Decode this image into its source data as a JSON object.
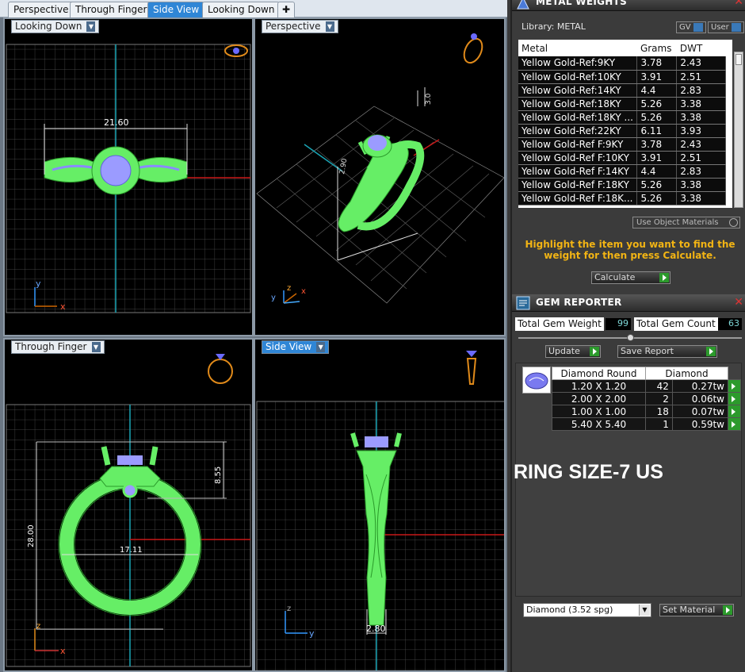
{
  "tabs": [
    {
      "label": "Perspective",
      "active": false
    },
    {
      "label": "Through Finger",
      "active": false
    },
    {
      "label": "Side View",
      "active": true
    },
    {
      "label": "Looking Down",
      "active": false
    }
  ],
  "viewports": {
    "looking_down": {
      "label": "Looking Down",
      "dim_width": "21.60",
      "axis_y": "y",
      "axis_x": "x"
    },
    "perspective": {
      "label": "Perspective",
      "dim_a": "3.0",
      "dim_b": "2.90",
      "axis_y": "y",
      "axis_z": "z",
      "axis_x": "x"
    },
    "through_finger": {
      "label": "Through Finger",
      "dim_height": "28.00",
      "dim_head": "8.55",
      "dim_inner": "17.11",
      "axis_z": "z",
      "axis_x": "x"
    },
    "side_view": {
      "label": "Side View",
      "dim_width": "2.80",
      "axis_z": "z",
      "axis_y": "y"
    }
  },
  "metal_weights": {
    "title": "METAL WEIGHTS",
    "library_label": "Library: METAL",
    "chip_gv": "GV",
    "chip_user": "User",
    "columns": [
      "Metal",
      "Grams",
      "DWT"
    ],
    "rows": [
      [
        "Yellow Gold-Ref:9KY",
        "3.78",
        "2.43"
      ],
      [
        "Yellow Gold-Ref:10KY",
        "3.91",
        "2.51"
      ],
      [
        "Yellow Gold-Ref:14KY",
        "4.4",
        "2.83"
      ],
      [
        "Yellow Gold-Ref:18KY",
        "5.26",
        "3.38"
      ],
      [
        "Yellow Gold-Ref:18KY ...",
        "5.26",
        "3.38"
      ],
      [
        "Yellow Gold-Ref:22KY",
        "6.11",
        "3.93"
      ],
      [
        "Yellow Gold-Ref F:9KY",
        "3.78",
        "2.43"
      ],
      [
        "Yellow Gold-Ref F:10KY",
        "3.91",
        "2.51"
      ],
      [
        "Yellow Gold-Ref F:14KY",
        "4.4",
        "2.83"
      ],
      [
        "Yellow Gold-Ref F:18KY",
        "5.26",
        "3.38"
      ],
      [
        "Yellow Gold-Ref F:18K...",
        "5.26",
        "3.38"
      ]
    ],
    "use_object_materials": "Use Object Materials",
    "hint": "Highlight the item you want to find the weight for then press Calculate.",
    "calculate_label": "Calculate"
  },
  "gem_reporter": {
    "title": "GEM REPORTER",
    "total_weight_label": "Total Gem Weight",
    "total_weight_value": "99",
    "total_count_label": "Total Gem Count",
    "total_count_value": "63",
    "update_label": "Update",
    "save_report_label": "Save Report",
    "columns": [
      "Diamond Round",
      "Diamond"
    ],
    "rows": [
      {
        "size": "1.20 X 1.20",
        "count": "42",
        "tw": "0.27tw"
      },
      {
        "size": "2.00 X 2.00",
        "count": "2",
        "tw": "0.06tw"
      },
      {
        "size": "1.00 X 1.00",
        "count": "18",
        "tw": "0.07tw"
      },
      {
        "size": "5.40 X 5.40",
        "count": "1",
        "tw": "0.59tw"
      }
    ],
    "ring_size": "RING SIZE-7 US",
    "material_select": "Diamond     (3.52 spg)",
    "set_material_label": "Set Material"
  }
}
